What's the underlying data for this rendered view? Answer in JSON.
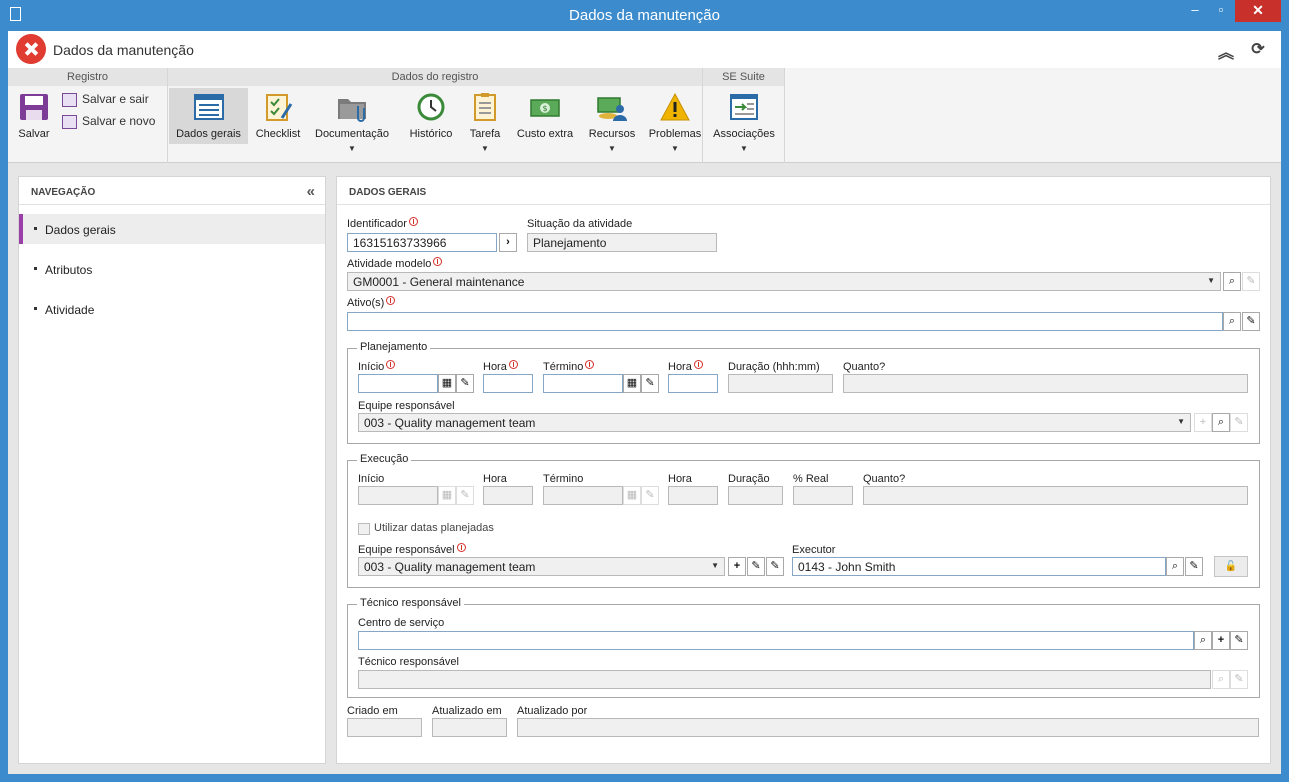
{
  "window": {
    "title": "Dados da manutenção",
    "minimize": "–",
    "maximize": "▫",
    "close": "✕"
  },
  "app": {
    "title": "Dados da manutenção"
  },
  "ribbon": {
    "groups": {
      "registro": "Registro",
      "dados_registro": "Dados do registro",
      "se_suite": "SE Suite"
    },
    "salvar": "Salvar",
    "salvar_sair": "Salvar e sair",
    "salvar_novo": "Salvar e novo",
    "buttons": {
      "dados_gerais": "Dados gerais",
      "checklist": "Checklist",
      "documentacao": "Documentação",
      "historico": "Histórico",
      "tarefa": "Tarefa",
      "custo_extra": "Custo extra",
      "recursos": "Recursos",
      "problemas": "Problemas",
      "associacoes": "Associações"
    }
  },
  "nav": {
    "title": "NAVEGAÇÃO",
    "collapse": "«",
    "items": [
      "Dados gerais",
      "Atributos",
      "Atividade"
    ]
  },
  "main": {
    "title": "DADOS GERAIS",
    "identificador": {
      "label": "Identificador",
      "value": "16315163733966"
    },
    "situacao": {
      "label": "Situação da atividade",
      "value": "Planejamento"
    },
    "atividade_modelo": {
      "label": "Atividade modelo",
      "value": "GM0001 - General maintenance"
    },
    "ativos": {
      "label": "Ativo(s)",
      "value": ""
    },
    "planejamento": {
      "legend": "Planejamento",
      "inicio": "Início",
      "hora": "Hora",
      "termino": "Término",
      "hora2": "Hora",
      "duracao": "Duração (hhh:mm)",
      "quanto": "Quanto?",
      "equipe_label": "Equipe responsável",
      "equipe_value": "003 - Quality management team"
    },
    "execucao": {
      "legend": "Execução",
      "inicio": "Início",
      "hora": "Hora",
      "termino": "Término",
      "hora2": "Hora",
      "duracao": "Duração",
      "real": "% Real",
      "quanto": "Quanto?",
      "utilizar": "Utilizar datas planejadas",
      "equipe_label": "Equipe responsável",
      "equipe_value": "003 - Quality management team",
      "executor_label": "Executor",
      "executor_value": "0143 - John Smith"
    },
    "tecnico": {
      "legend": "Técnico responsável",
      "centro_label": "Centro de serviço",
      "tecnico_label": "Técnico responsável"
    },
    "footer": {
      "criado": "Criado em",
      "atualizado_em": "Atualizado em",
      "atualizado_por": "Atualizado por"
    }
  }
}
